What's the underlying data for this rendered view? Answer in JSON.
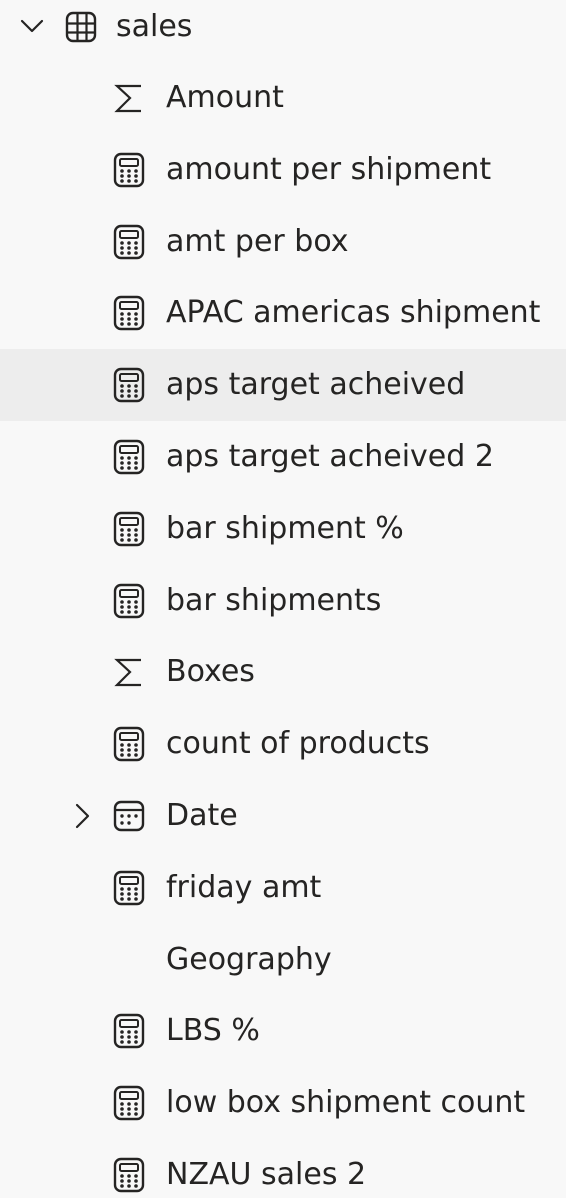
{
  "table": {
    "name": "sales",
    "expanded": true,
    "chevron_icon": "chevron-down-icon",
    "table_icon": "table-grid-icon"
  },
  "fields": [
    {
      "label": "Amount",
      "icon": "sigma-icon"
    },
    {
      "label": "amount per shipment",
      "icon": "calculator-icon"
    },
    {
      "label": "amt per box",
      "icon": "calculator-icon"
    },
    {
      "label": "APAC americas shipment",
      "icon": "calculator-icon"
    },
    {
      "label": "aps target acheived",
      "icon": "calculator-icon",
      "hovered": true
    },
    {
      "label": "aps target acheived 2",
      "icon": "calculator-icon"
    },
    {
      "label": "bar shipment %",
      "icon": "calculator-icon"
    },
    {
      "label": "bar shipments",
      "icon": "calculator-icon"
    },
    {
      "label": "Boxes",
      "icon": "sigma-icon"
    },
    {
      "label": "count of products",
      "icon": "calculator-icon"
    },
    {
      "label": "Date",
      "icon": "calendar-icon",
      "expandable": true,
      "chevron_icon": "chevron-right-icon"
    },
    {
      "label": "friday amt",
      "icon": "calculator-icon"
    },
    {
      "label": "Geography",
      "icon": ""
    },
    {
      "label": "LBS %",
      "icon": "calculator-icon"
    },
    {
      "label": "low box shipment count",
      "icon": "calculator-icon"
    },
    {
      "label": "NZAU sales 2",
      "icon": "calculator-icon"
    }
  ],
  "colors": {
    "background": "#f8f8f8",
    "hover": "#ededed",
    "text": "#252423",
    "icon": "#252423"
  }
}
